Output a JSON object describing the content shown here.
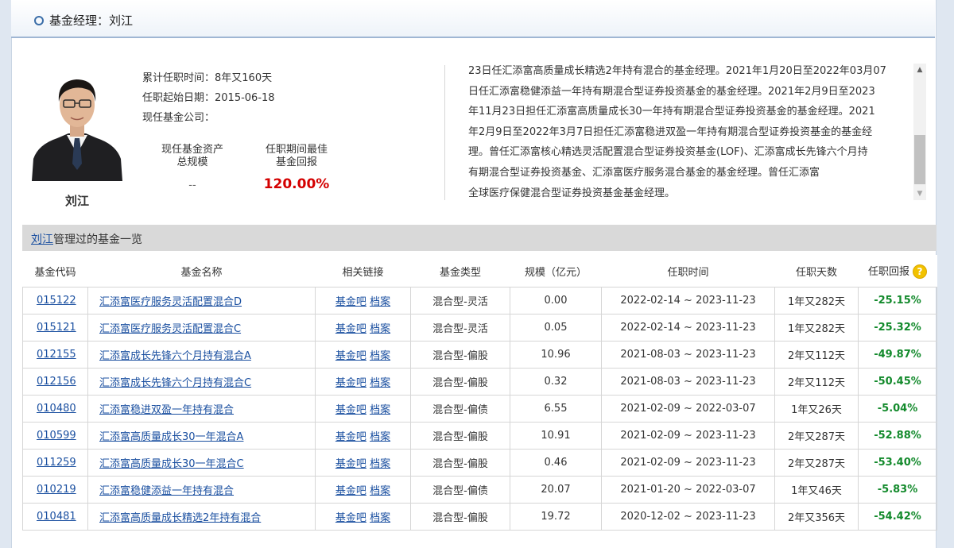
{
  "header": {
    "title": "基金经理：刘江"
  },
  "manager": {
    "name": "刘江",
    "tenure_label": "累计任职时间：",
    "tenure_value": "8年又160天",
    "start_label": "任职起始日期：",
    "start_value": "2015-06-18",
    "company_label": "现任基金公司："
  },
  "stats": {
    "assets_label_1": "现任基金资产",
    "assets_label_2": "总规模",
    "assets_value": "--",
    "best_label_1": "任职期间最佳",
    "best_label_2": "基金回报",
    "best_value": "120.00%"
  },
  "bio": {
    "lines": [
      "23日任汇添富高质量成长精选2年持有混合的基金经理。2021年1月20日至2022年03月07",
      "日任汇添富稳健添益一年持有期混合型证券投资基金的基金经理。2021年2月9日至2023",
      "年11月23日担任汇添富高质量成长30一年持有期混合型证券投资基金的基金经理。2021",
      "年2月9日至2022年3月7日担任汇添富稳进双盈一年持有期混合型证券投资基金的基金经",
      "理。曾任汇添富核心精选灵活配置混合型证券投资基金(LOF)、汇添富成长先锋六个月持",
      "有期混合型证券投资基金、汇添富医疗服务混合基金的基金经理。曾任汇添富",
      "全球医疗保健混合型证券投资基金基金经理。"
    ]
  },
  "list": {
    "manager_link": "刘江",
    "title_suffix": "管理过的基金一览"
  },
  "table": {
    "headers": [
      "基金代码",
      "基金名称",
      "相关链接",
      "基金类型",
      "规模（亿元）",
      "任职时间",
      "任职天数",
      "任职回报"
    ],
    "link1": "基金吧",
    "link2": "档案",
    "rows": [
      {
        "code": "015122",
        "name": "汇添富医疗服务灵活配置混合D",
        "type": "混合型-灵活",
        "size": "0.00",
        "period": "2022-02-14 ~ 2023-11-23",
        "days": "1年又282天",
        "ret": "-25.15%"
      },
      {
        "code": "015121",
        "name": "汇添富医疗服务灵活配置混合C",
        "type": "混合型-灵活",
        "size": "0.05",
        "period": "2022-02-14 ~ 2023-11-23",
        "days": "1年又282天",
        "ret": "-25.32%"
      },
      {
        "code": "012155",
        "name": "汇添富成长先锋六个月持有混合A",
        "type": "混合型-偏股",
        "size": "10.96",
        "period": "2021-08-03 ~ 2023-11-23",
        "days": "2年又112天",
        "ret": "-49.87%"
      },
      {
        "code": "012156",
        "name": "汇添富成长先锋六个月持有混合C",
        "type": "混合型-偏股",
        "size": "0.32",
        "period": "2021-08-03 ~ 2023-11-23",
        "days": "2年又112天",
        "ret": "-50.45%"
      },
      {
        "code": "010480",
        "name": "汇添富稳进双盈一年持有混合",
        "type": "混合型-偏债",
        "size": "6.55",
        "period": "2021-02-09 ~ 2022-03-07",
        "days": "1年又26天",
        "ret": "-5.04%"
      },
      {
        "code": "010599",
        "name": "汇添富高质量成长30一年混合A",
        "type": "混合型-偏股",
        "size": "10.91",
        "period": "2021-02-09 ~ 2023-11-23",
        "days": "2年又287天",
        "ret": "-52.88%"
      },
      {
        "code": "011259",
        "name": "汇添富高质量成长30一年混合C",
        "type": "混合型-偏股",
        "size": "0.46",
        "period": "2021-02-09 ~ 2023-11-23",
        "days": "2年又287天",
        "ret": "-53.40%"
      },
      {
        "code": "010219",
        "name": "汇添富稳健添益一年持有混合",
        "type": "混合型-偏债",
        "size": "20.07",
        "period": "2021-01-20 ~ 2022-03-07",
        "days": "1年又46天",
        "ret": "-5.83%"
      },
      {
        "code": "010481",
        "name": "汇添富高质量成长精选2年持有混合",
        "type": "混合型-偏股",
        "size": "19.72",
        "period": "2020-12-02 ~ 2023-11-23",
        "days": "2年又356天",
        "ret": "-54.42%"
      }
    ]
  },
  "colors": {
    "accent": "#1a4fa0",
    "return_negative": "#138a2c",
    "return_best": "#d40000"
  }
}
